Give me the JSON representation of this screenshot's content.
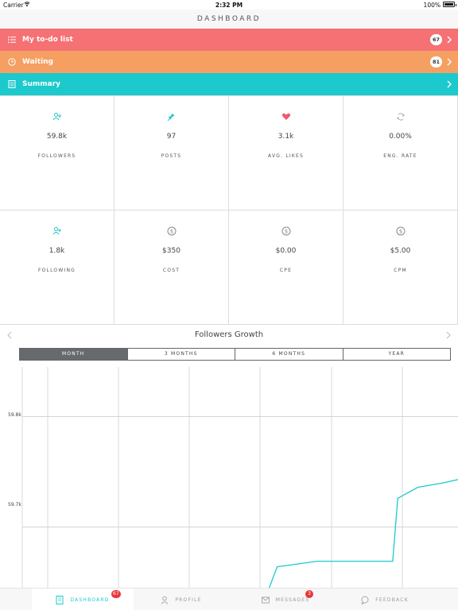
{
  "status_bar": {
    "carrier": "Carrier",
    "time": "2:32 PM",
    "battery": "100%"
  },
  "nav": {
    "title": "DASHBOARD"
  },
  "rows": {
    "todo": {
      "label": "My to-do list",
      "count": "67",
      "color": "#f57174"
    },
    "waiting": {
      "label": "Waiting",
      "count": "81",
      "color": "#f5a062"
    },
    "summary": {
      "label": "Summary",
      "color": "#1cc9cc"
    }
  },
  "metrics": [
    {
      "value": "59.8k",
      "label": "FOLLOWERS",
      "icon": "add-user-icon"
    },
    {
      "value": "97",
      "label": "POSTS",
      "icon": "pin-icon"
    },
    {
      "value": "3.1k",
      "label": "AVG. LIKES",
      "icon": "heart-icon"
    },
    {
      "value": "0.00%",
      "label": "ENG. RATE",
      "icon": "refresh-icon"
    },
    {
      "value": "1.8k",
      "label": "FOLLOWING",
      "icon": "add-user-icon"
    },
    {
      "value": "$350",
      "label": "COST",
      "icon": "dollar-icon"
    },
    {
      "value": "$0.00",
      "label": "CPE",
      "icon": "dollar-icon"
    },
    {
      "value": "$5.00",
      "label": "CPM",
      "icon": "dollar-icon"
    }
  ],
  "chart_section": {
    "title": "Followers Growth",
    "segments": [
      "MONTH",
      "3 MONTHS",
      "6 MONTHS",
      "YEAR"
    ],
    "selected_segment": "MONTH"
  },
  "chart_data": {
    "type": "line",
    "title": "",
    "xlabel": "",
    "ylabel": "",
    "y_ticks": [
      "59.8k",
      "59.7k"
    ],
    "ylim": [
      59645,
      59845
    ],
    "grid": true,
    "series": [
      {
        "color": "#1cc9cc",
        "x": [
          0.0,
          0.02,
          0.1,
          0.18,
          0.25,
          0.26,
          0.3,
          0.35,
          0.38
        ],
        "y": [
          59640,
          59664,
          59669,
          59669,
          59669,
          59726,
          59736,
          59740,
          59743
        ]
      }
    ]
  },
  "tabs": [
    {
      "label": "DASHBOARD",
      "badge": "67",
      "icon": "dashboard-icon",
      "active": true
    },
    {
      "label": "PROFILE",
      "icon": "profile-icon"
    },
    {
      "label": "MESSAGES",
      "badge": "3",
      "icon": "envelope-icon"
    },
    {
      "label": "FEEDBACK",
      "icon": "chat-bubble-icon"
    }
  ]
}
